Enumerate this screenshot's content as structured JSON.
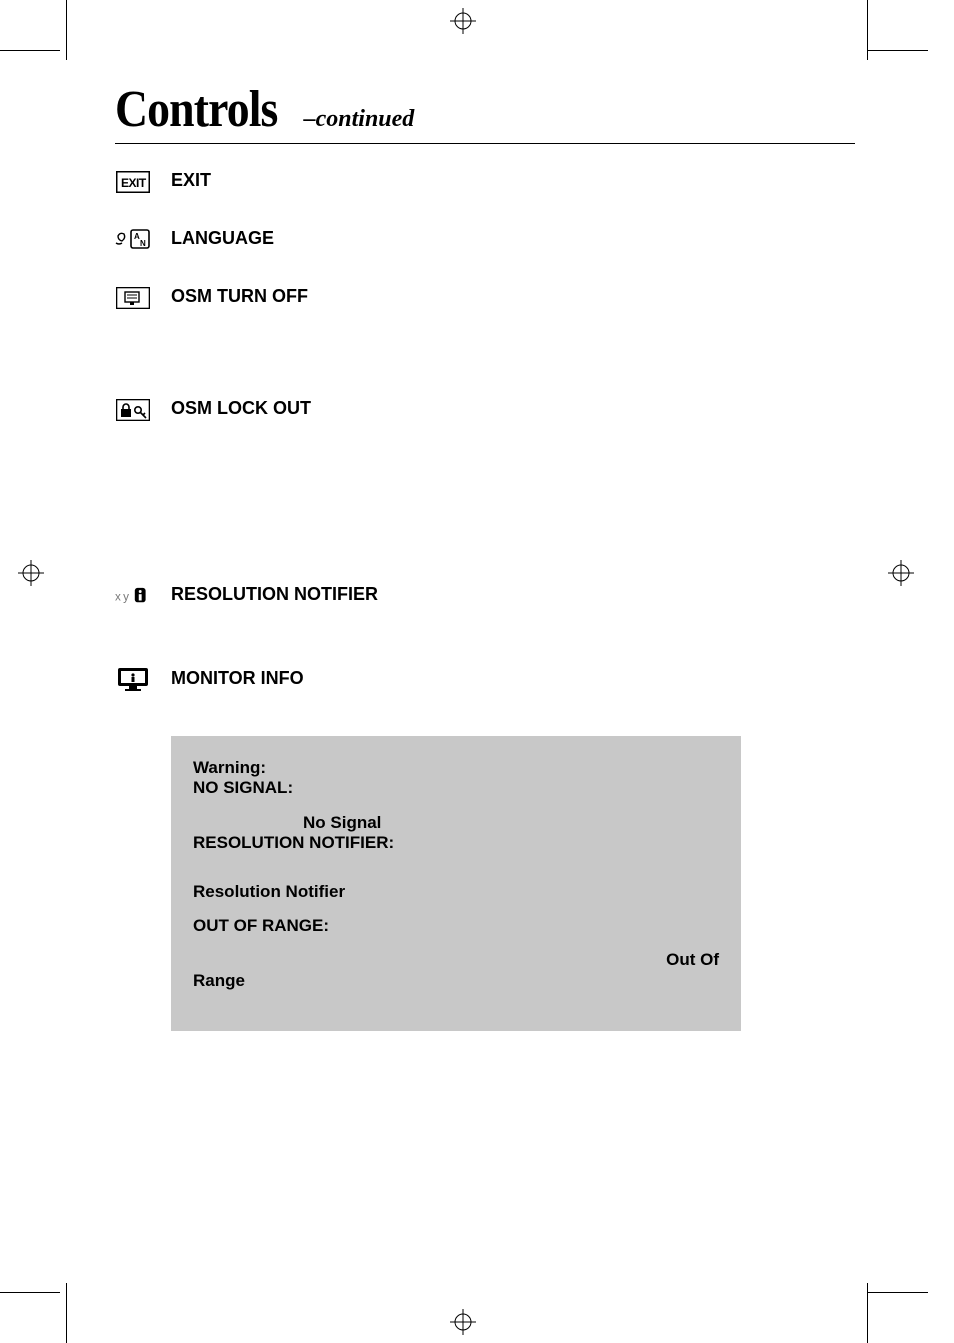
{
  "title": {
    "main": "Controls",
    "sub": "–continued"
  },
  "items": [
    {
      "label": "EXIT"
    },
    {
      "label": "LANGUAGE"
    },
    {
      "label": "OSM TURN OFF"
    },
    {
      "label": "OSM LOCK OUT"
    },
    {
      "label": "RESOLUTION NOTIFIER"
    },
    {
      "label": "MONITOR INFO"
    }
  ],
  "warning": {
    "heading": "Warning:",
    "no_signal_label": "NO SIGNAL:",
    "no_signal_text": "No Signal",
    "res_notifier_label": "RESOLUTION  NOTIFIER:",
    "res_notifier_text": "Resolution Notifier",
    "out_of_range_label": "OUT OF RANGE:",
    "out_of_text": "Out Of",
    "range_text": "Range"
  }
}
